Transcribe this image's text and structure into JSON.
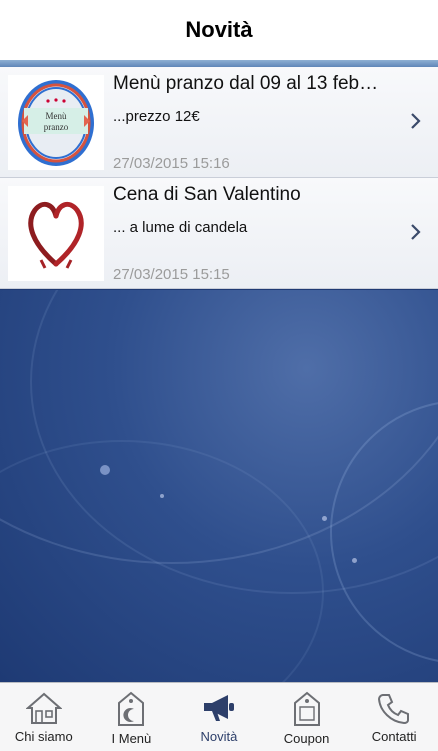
{
  "header": {
    "title": "Novità"
  },
  "items": [
    {
      "title": "Menù pranzo dal 09 al 13 feb…",
      "subtitle": "...prezzo 12€",
      "date": "27/03/2015 15:16",
      "thumb": {
        "line1": "Menù",
        "line2": "pranzo",
        "icon": "menu-pranzo-logo"
      }
    },
    {
      "title": "Cena di San Valentino",
      "subtitle": "... a lume di candela",
      "date": "27/03/2015 15:15",
      "thumb": {
        "icon": "wine-heart-image"
      }
    }
  ],
  "tabs": [
    {
      "label": "Chi siamo",
      "icon": "house-icon"
    },
    {
      "label": "I Menù",
      "icon": "menu-tag-icon"
    },
    {
      "label": "Novità",
      "icon": "megaphone-icon",
      "active": true
    },
    {
      "label": "Coupon",
      "icon": "coupon-tag-icon"
    },
    {
      "label": "Contatti",
      "icon": "phone-icon"
    }
  ],
  "colors": {
    "accent": "#2d3f6a",
    "background": "#1f3a73"
  }
}
